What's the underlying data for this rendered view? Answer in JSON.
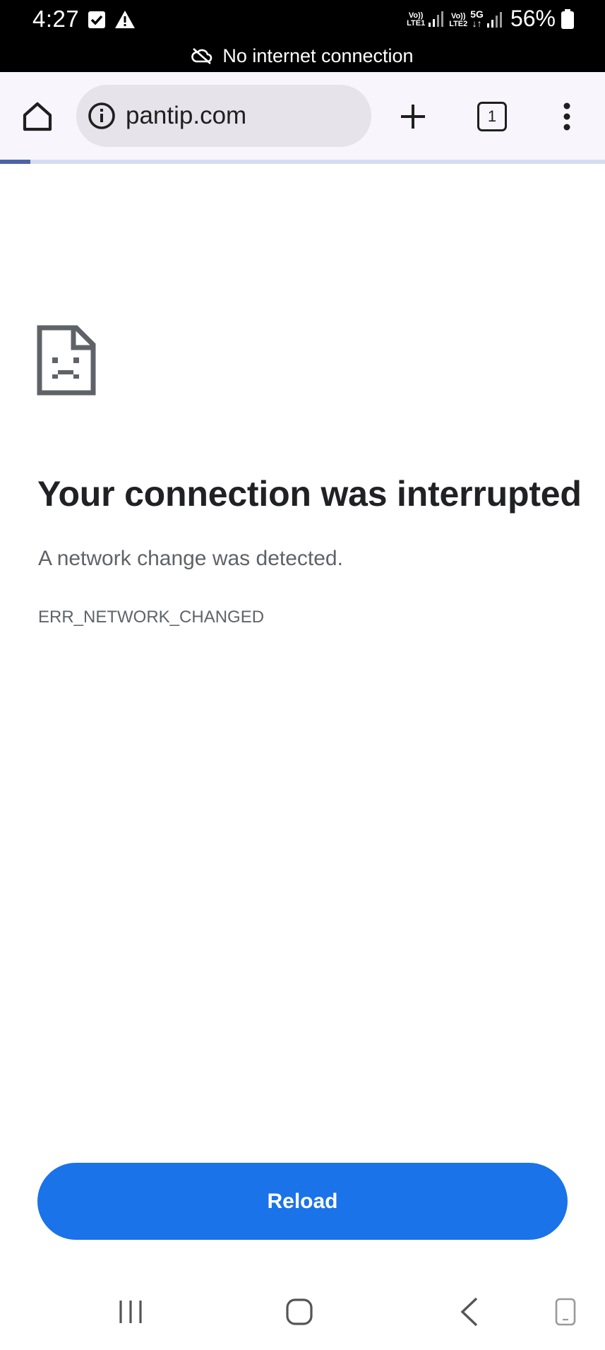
{
  "status_bar": {
    "time": "4:27",
    "left_icons": [
      "check-box-icon",
      "warning-icon"
    ],
    "sim1_label_top": "Vo))",
    "sim1_label_bottom": "LTE1",
    "sim2_label_top": "Vo))",
    "sim2_label_bottom": "LTE2",
    "network_type": "5G",
    "battery_percent": "56%",
    "offline_message": "No internet connection"
  },
  "toolbar": {
    "url": "pantip.com",
    "tab_count": "1",
    "icons": [
      "home-icon",
      "info-icon",
      "plus-icon",
      "tab-switcher-icon",
      "more-vert-icon"
    ]
  },
  "page": {
    "load_progress": 0.05,
    "title": "Your connection was interrupted",
    "description": "A network change was detected.",
    "error_code": "ERR_NETWORK_CHANGED",
    "reload_label": "Reload"
  },
  "nav_bar": {
    "icons": [
      "recents-icon",
      "home-nav-icon",
      "back-icon",
      "keyboard-toggle-icon"
    ]
  },
  "colors": {
    "status_bar_bg": "#000000",
    "toolbar_bg": "#f8f6fc",
    "omnibox_bg": "#e6e3ea",
    "accent": "#1a73e8",
    "title_text": "#202124",
    "secondary_text": "#5f6368"
  }
}
